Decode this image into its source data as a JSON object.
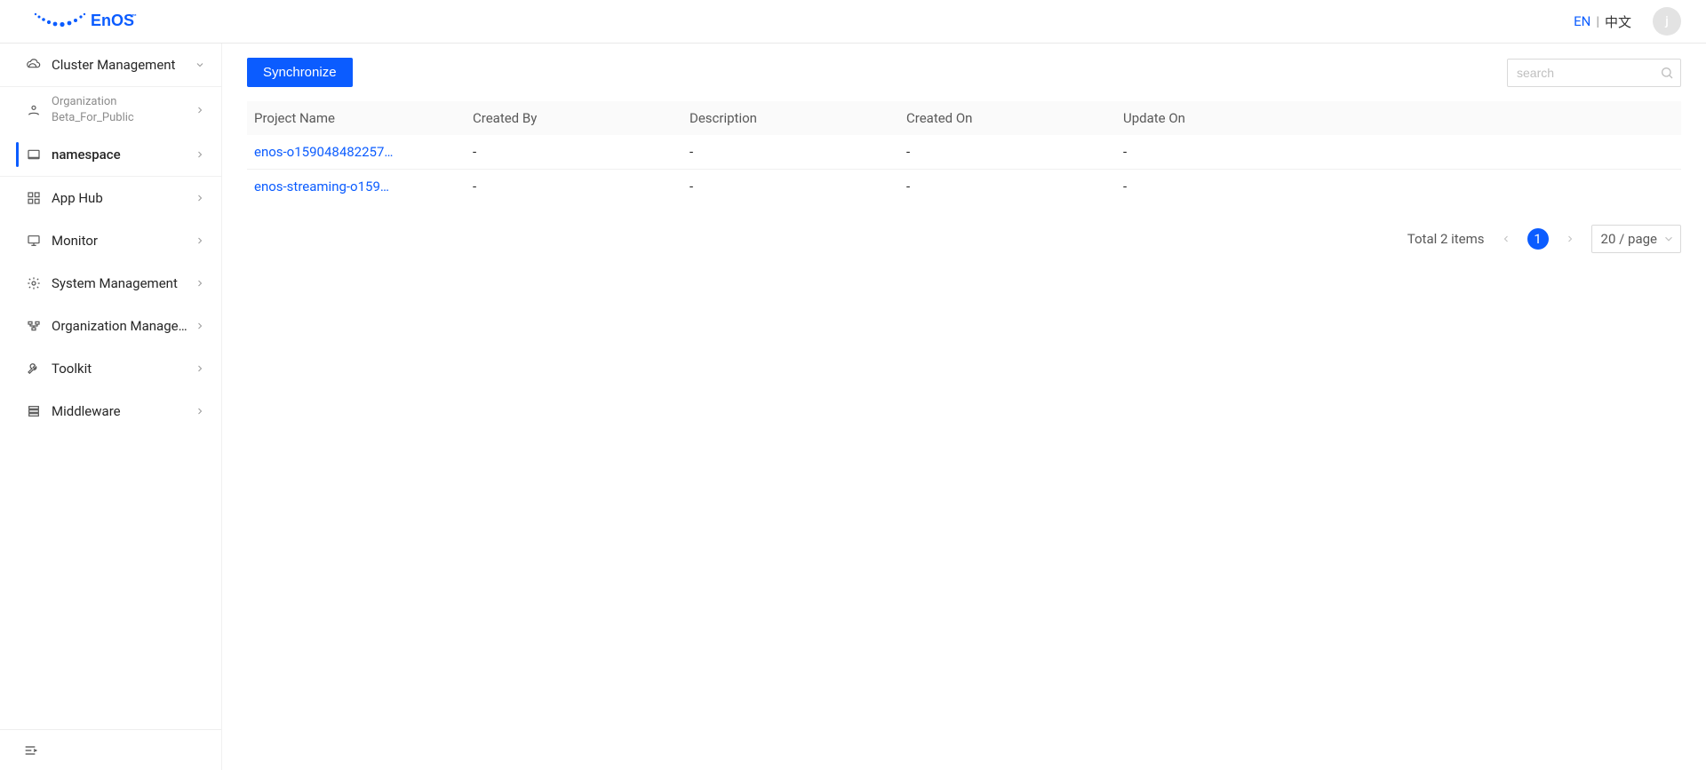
{
  "header": {
    "brand": "EnOS™",
    "lang_en": "EN",
    "lang_sep": "|",
    "lang_cn": "中文",
    "avatar_initial": "j"
  },
  "sidebar": {
    "items": [
      {
        "id": "cluster-management",
        "label": "Cluster Management",
        "arrow": "down"
      },
      {
        "id": "organization",
        "is_org": true,
        "org_title": "Organization",
        "org_name": "Beta_For_Public",
        "arrow": "right"
      },
      {
        "id": "namespace",
        "label": "namespace",
        "arrow": "right",
        "selected": true
      },
      {
        "id": "app-hub",
        "label": "App Hub",
        "arrow": "right"
      },
      {
        "id": "monitor",
        "label": "Monitor",
        "arrow": "right"
      },
      {
        "id": "system-management",
        "label": "System Management",
        "arrow": "right"
      },
      {
        "id": "organization-management",
        "label": "Organization Manage…",
        "arrow": "right"
      },
      {
        "id": "toolkit",
        "label": "Toolkit",
        "arrow": "right"
      },
      {
        "id": "middleware",
        "label": "Middleware",
        "arrow": "right"
      }
    ]
  },
  "actions": {
    "synchronize": "Synchronize",
    "search_placeholder": "search"
  },
  "table": {
    "columns": [
      "Project Name",
      "Created By",
      "Description",
      "Created On",
      "Update On"
    ],
    "rows": [
      {
        "name": "enos-o159048482257…",
        "created_by": "-",
        "description": "-",
        "created_on": "-",
        "update_on": "-"
      },
      {
        "name": "enos-streaming-o159…",
        "created_by": "-",
        "description": "-",
        "created_on": "-",
        "update_on": "-"
      }
    ]
  },
  "pagination": {
    "total_text": "Total 2 items",
    "current_page": "1",
    "page_size_label": "20 / page"
  }
}
